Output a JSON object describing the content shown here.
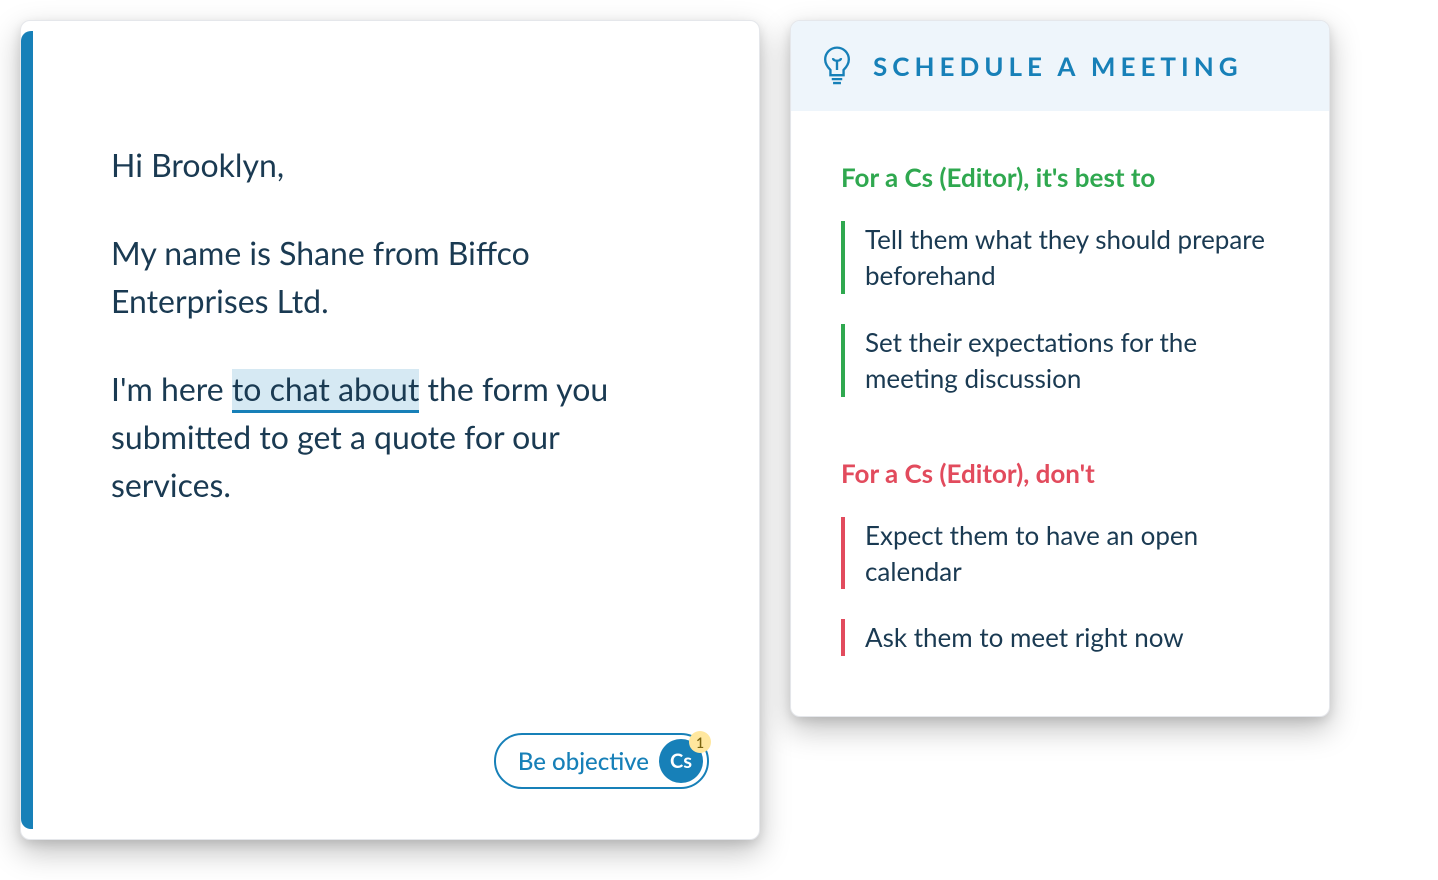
{
  "email": {
    "greeting": "Hi Brooklyn,",
    "intro": "My name is Shane from Biffco Enterprises Ltd.",
    "message_pre": "I'm here ",
    "highlighted": "to chat about",
    "message_post": " the form you submitted to get a quote for our services.",
    "suggestion": {
      "label": "Be objective",
      "badge": "Cs",
      "count": "1"
    }
  },
  "tips": {
    "title": "SCHEDULE A MEETING",
    "do_title": "For a Cs (Editor), it's best to",
    "do_items": [
      "Tell them what they should prepare beforehand",
      "Set their expectations for the meeting discussion"
    ],
    "dont_title": "For a Cs (Editor), don't",
    "dont_items": [
      "Expect them to have an open calendar",
      "Ask them to meet right now"
    ]
  }
}
